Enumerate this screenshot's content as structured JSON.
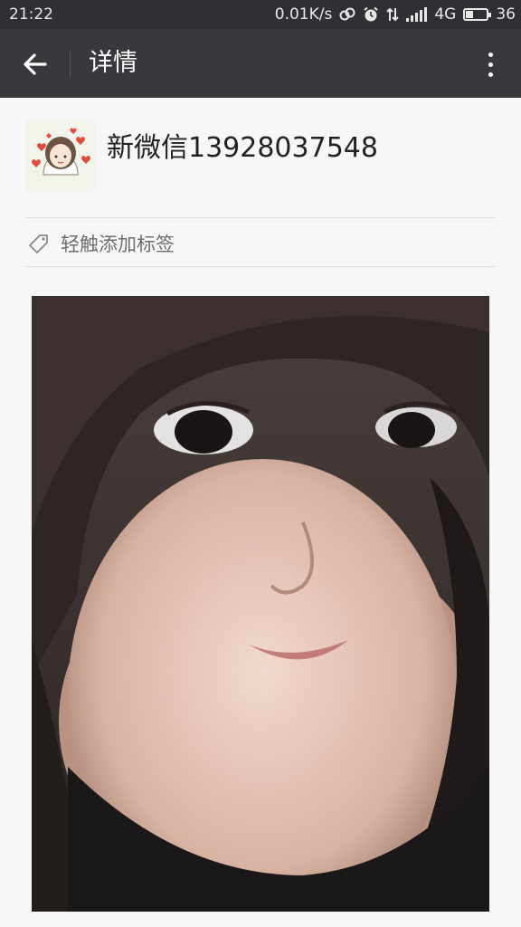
{
  "status_bar": {
    "time": "21:22",
    "network_speed": "0.01K/s",
    "network_type": "4G",
    "battery_level": "36",
    "icons": [
      "link-icon",
      "alarm-icon",
      "data-transfer-icon",
      "signal-icon",
      "battery-icon"
    ]
  },
  "app_bar": {
    "title": "详情",
    "back_icon": "arrow-left-icon",
    "menu_icon": "more-vertical-icon"
  },
  "profile": {
    "name": "新微信13928037548",
    "avatar_icon": "cartoon-girl-avatar"
  },
  "tag": {
    "label": "轻触添加标签",
    "icon": "tag-icon"
  },
  "photo": {
    "description_icon": "profile-photo"
  },
  "colors": {
    "status_bar_bg": "#2f3033",
    "app_bar_bg": "#38393c",
    "page_bg": "#f7f7f7"
  }
}
